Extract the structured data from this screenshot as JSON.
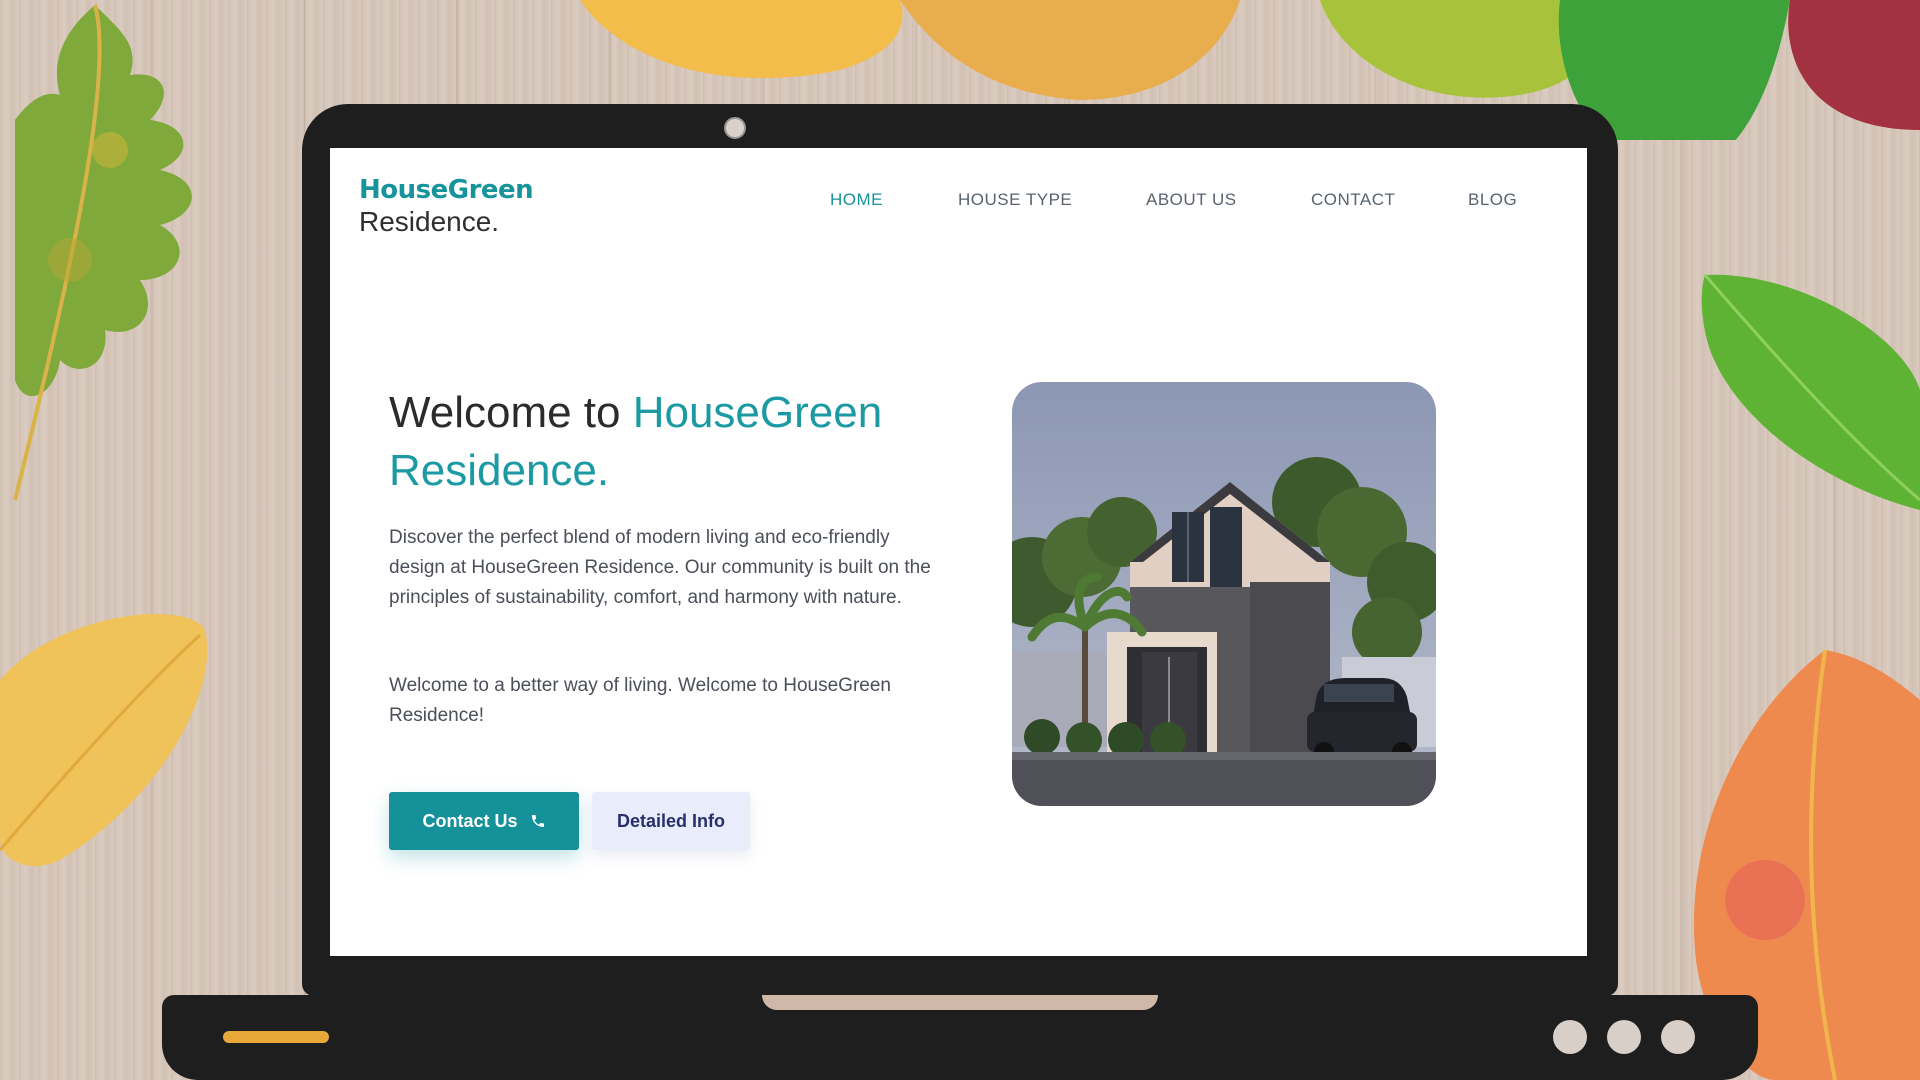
{
  "site": {
    "logo_line1": "HouseGreen",
    "logo_line2": "Residence."
  },
  "nav": {
    "items": [
      {
        "label": "HOME",
        "active": true
      },
      {
        "label": "HOUSE TYPE",
        "active": false
      },
      {
        "label": "ABOUT US",
        "active": false
      },
      {
        "label": "CONTACT",
        "active": false
      },
      {
        "label": "BLOG",
        "active": false
      }
    ]
  },
  "hero": {
    "title_prefix": "Welcome to ",
    "title_accent": "HouseGreen Residence.",
    "paragraph_1": "Discover the perfect blend of modern living and eco-friendly design at HouseGreen Residence. Our community is built on the principles of sustainability, comfort, and harmony with nature.",
    "paragraph_2": "Welcome to a better way of living. Welcome to HouseGreen Residence!",
    "primary_button": "Contact Us",
    "primary_button_icon": "phone-icon",
    "secondary_button": "Detailed Info"
  },
  "colors": {
    "accent": "#17939b",
    "text_dark": "#2b2b2b",
    "text_body": "#4b4f58",
    "secondary_button_bg": "#e9ecfb",
    "laptop_frame": "#1e1e1e",
    "base_light": "#e8a93a"
  }
}
